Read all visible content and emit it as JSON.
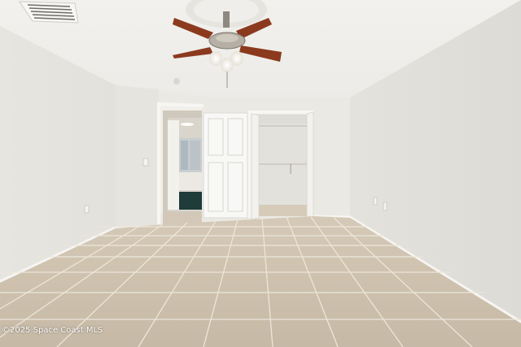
{
  "watermark": {
    "text": "©2025 Space Coast MLS"
  }
}
